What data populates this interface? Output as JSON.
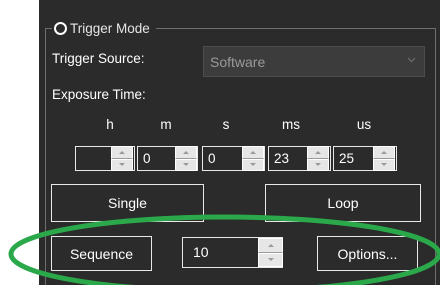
{
  "group": {
    "title": "Trigger Mode",
    "radio_selected": false
  },
  "trigger_source": {
    "label": "Trigger Source:",
    "value": "Software",
    "enabled": false
  },
  "exposure": {
    "label": "Exposure Time:",
    "units": [
      "h",
      "m",
      "s",
      "ms",
      "us"
    ],
    "values": [
      "",
      "0",
      "0",
      "23",
      "25"
    ]
  },
  "buttons": {
    "single": "Single",
    "loop": "Loop",
    "sequence": "Sequence",
    "options": "Options..."
  },
  "sequence_count": "10",
  "colors": {
    "panel": "#2b2b2b",
    "annotation": "#2aa84a"
  },
  "icons": {
    "combo": "chevron-down-icon",
    "spin_up": "arrow-up-icon",
    "spin_down": "arrow-down-icon"
  }
}
